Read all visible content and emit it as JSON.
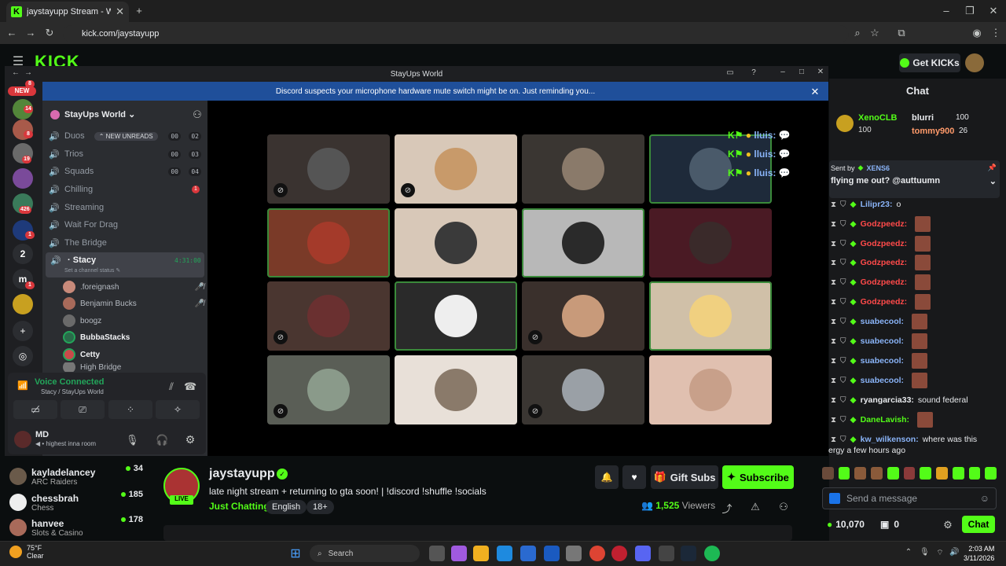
{
  "browser": {
    "tab_title": "jaystayupp Stream - Watch Live",
    "url": "kick.com/jaystayupp"
  },
  "kick": {
    "search_placeholder": "Search",
    "get_kicks": "Get KICKs",
    "chat_title": "Chat",
    "gifters": [
      {
        "name": "XenoCLB",
        "value": "100"
      },
      {
        "name": "blurri",
        "value": "100"
      },
      {
        "name": "tommy900",
        "value": "26"
      }
    ],
    "pinned": {
      "sent_by": "Sent by",
      "user": "XENS6",
      "text": "flying me out? @auttuumn"
    },
    "chat": [
      {
        "user": "Lilipr23:",
        "text": "o",
        "color": "#8ab4f8",
        "emote": false
      },
      {
        "user": "Godzpeedz:",
        "text": "",
        "color": "#ff4a4a",
        "emote": true
      },
      {
        "user": "Godzpeedz:",
        "text": "",
        "color": "#ff4a4a",
        "emote": true
      },
      {
        "user": "Godzpeedz:",
        "text": "",
        "color": "#ff4a4a",
        "emote": true
      },
      {
        "user": "Godzpeedz:",
        "text": "",
        "color": "#ff4a4a",
        "emote": true
      },
      {
        "user": "Godzpeedz:",
        "text": "",
        "color": "#ff4a4a",
        "emote": true
      },
      {
        "user": "suabecool:",
        "text": "",
        "color": "#8ab4f8",
        "emote": true
      },
      {
        "user": "suabecool:",
        "text": "",
        "color": "#8ab4f8",
        "emote": true
      },
      {
        "user": "suabecool:",
        "text": "",
        "color": "#8ab4f8",
        "emote": true
      },
      {
        "user": "suabecool:",
        "text": "",
        "color": "#8ab4f8",
        "emote": true
      },
      {
        "user": "ryangarcia33:",
        "text": "sound federal",
        "color": "#e8eaed",
        "emote": false
      },
      {
        "user": "DaneLavish:",
        "text": "",
        "color": "#53fc18",
        "emote": true
      },
      {
        "user": "kw_wilkenson:",
        "text": "where was this",
        "color": "#8ab4f8",
        "emote": false
      }
    ],
    "chat_cont": "ergy a few hours ago",
    "send_placeholder": "Send a message",
    "kicks_balance": "10,070",
    "other_balance": "0",
    "chat_button": "Chat",
    "recommended": [
      {
        "name": "kayladelancey",
        "category": "ARC Raiders",
        "viewers": "34"
      },
      {
        "name": "chessbrah",
        "category": "Chess",
        "viewers": "185"
      },
      {
        "name": "hanvee",
        "category": "Slots & Casino",
        "viewers": "178"
      }
    ],
    "stream": {
      "streamer": "jaystayupp",
      "live": "LIVE",
      "title": "late night stream + returning to gta soon! | !discord !shuffle !socials",
      "category": "Just Chatting",
      "tags": [
        "English",
        "18+"
      ],
      "viewers": "1,525",
      "viewers_label": "Viewers",
      "gift_subs": "Gift Subs",
      "subscribe": "Subscribe"
    }
  },
  "discord": {
    "window_title": "StayUps World",
    "notice": "Discord suspects your microphone hardware mute switch might be on. Just reminding you...",
    "server_name": "StayUps World",
    "server_badges": [
      "NEW",
      "8",
      "14",
      "8",
      "19",
      "426",
      "1",
      "2",
      "1"
    ],
    "channels": [
      {
        "name": "Duos",
        "counts": [
          "00",
          "02"
        ],
        "new_unreads": "NEW UNREADS"
      },
      {
        "name": "Trios",
        "counts": [
          "00",
          "03"
        ]
      },
      {
        "name": "Squads",
        "counts": [
          "00",
          "04"
        ]
      },
      {
        "name": "Chilling",
        "red": "1"
      },
      {
        "name": "Streaming"
      },
      {
        "name": "Wait For Drag"
      },
      {
        "name": "The Bridge"
      }
    ],
    "active_channel": {
      "name": "Stacy",
      "timer": "4:31:00",
      "status": "Set a channel status"
    },
    "members": [
      ".foreignash",
      "Benjamin Bucks",
      "boogz",
      "BubbaStacks",
      "Cetty",
      "High Bridge"
    ],
    "voice": {
      "title": "Voice Connected",
      "sub": "Stacy / StayUps World"
    },
    "user": {
      "name": "MD",
      "status": "highest inna room"
    },
    "overlay_names": [
      "lluis:",
      "lluis:",
      "lluis:"
    ]
  }
}
